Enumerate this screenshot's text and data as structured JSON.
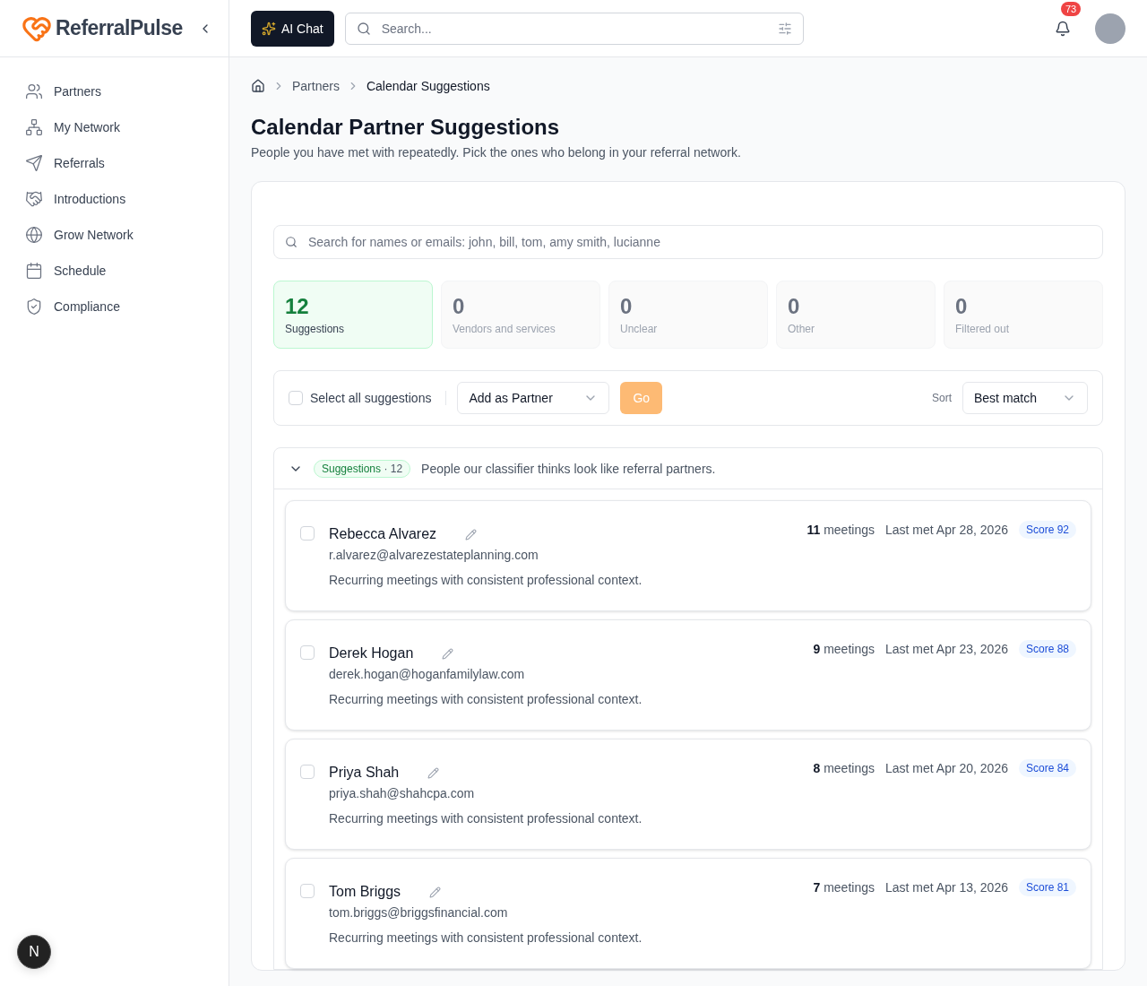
{
  "brand": {
    "name": "ReferralPulse"
  },
  "sidebar": {
    "items": [
      {
        "label": "Partners",
        "kind": "users"
      },
      {
        "label": "My Network",
        "kind": "network"
      },
      {
        "label": "Referrals",
        "kind": "send"
      },
      {
        "label": "Introductions",
        "kind": "handshake"
      },
      {
        "label": "Grow Network",
        "kind": "globe"
      },
      {
        "label": "Schedule",
        "kind": "calendar"
      },
      {
        "label": "Compliance",
        "kind": "shield"
      }
    ]
  },
  "dev_badge": "N",
  "header": {
    "ai_button": "AI Chat",
    "search": {
      "placeholder": "Search..."
    },
    "notification_count": "73"
  },
  "breadcrumb": [
    "Partners",
    "Calendar Suggestions"
  ],
  "page": {
    "title": "Calendar Partner Suggestions",
    "subtitle": "People you have met with repeatedly. Pick the ones who belong in your referral network."
  },
  "filter_search": {
    "placeholder": "Search for names or emails: john, bill, tom, amy smith, lucianne"
  },
  "stats": [
    {
      "count": "12",
      "label": "Suggestions",
      "selected": true
    },
    {
      "count": "0",
      "label": "Vendors and services",
      "selected": false
    },
    {
      "count": "0",
      "label": "Unclear",
      "selected": false
    },
    {
      "count": "0",
      "label": "Other",
      "selected": false
    },
    {
      "count": "0",
      "label": "Filtered out",
      "selected": false
    }
  ],
  "toolbar": {
    "select_all": {
      "label": "Select all suggestions",
      "checked": false
    },
    "action": "Add as Partner",
    "go": "Go",
    "sort_label": "Sort",
    "sort": "Best match"
  },
  "group": {
    "expanded": true,
    "tag": "Suggestions",
    "count": "· 12",
    "description": "People our classifier thinks look like referral partners."
  },
  "suggestions": [
    {
      "name": "Rebecca Alvarez",
      "email": "r.alvarez@alvarezestateplanning.com",
      "reason": "Recurring meetings with consistent professional context.",
      "meetings": "**11** meetings",
      "last_met": "Last met Apr 28, 2026",
      "score": "Score 92",
      "checked": false
    },
    {
      "name": "Derek Hogan",
      "email": "derek.hogan@hoganfamilylaw.com",
      "reason": "Recurring meetings with consistent professional context.",
      "meetings": "**9** meetings",
      "last_met": "Last met Apr 23, 2026",
      "score": "Score 88",
      "checked": false
    },
    {
      "name": "Priya Shah",
      "email": "priya.shah@shahcpa.com",
      "reason": "Recurring meetings with consistent professional context.",
      "meetings": "**8** meetings",
      "last_met": "Last met Apr 20, 2026",
      "score": "Score 84",
      "checked": false
    },
    {
      "name": "Tom Briggs",
      "email": "tom.briggs@briggsfinancial.com",
      "reason": "Recurring meetings with consistent professional context.",
      "meetings": "**7** meetings",
      "last_met": "Last met Apr 13, 2026",
      "score": "Score 81",
      "checked": false
    }
  ]
}
